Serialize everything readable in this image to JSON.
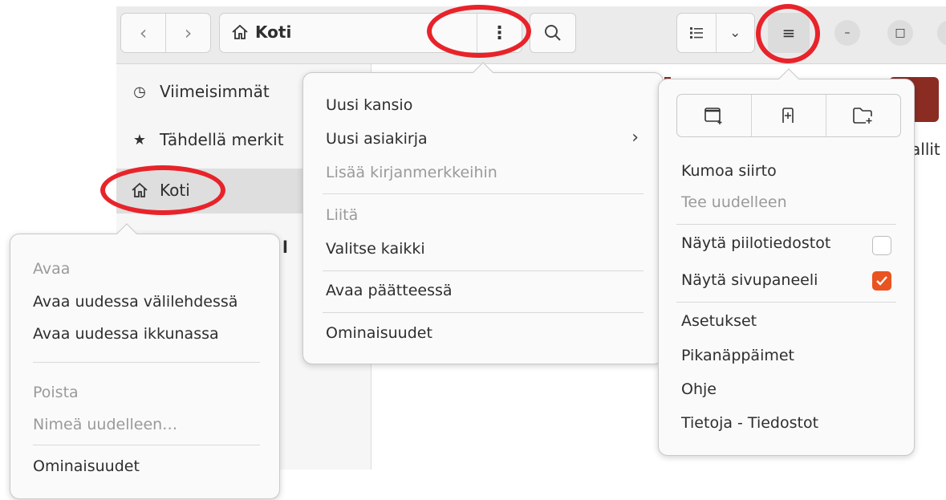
{
  "header": {
    "back_icon": "chevron-left-icon",
    "forward_icon": "chevron-right-icon",
    "path_label": "Koti",
    "path_icon": "home-icon",
    "path_menu_icon": "vertical-dots-icon",
    "search_icon": "search-icon",
    "view_icon": "list-view-icon",
    "view_dropdown_icon": "chevron-down-icon",
    "main_menu_icon": "hamburger-menu-icon",
    "minimize_icon": "minimize-icon",
    "maximize_icon": "maximize-icon"
  },
  "sidebar": {
    "items": [
      {
        "label": "Viimeisimmät",
        "icon": "clock-icon"
      },
      {
        "label": "Tähdellä merkit",
        "icon": "star-icon"
      },
      {
        "label": "Koti",
        "icon": "home-icon"
      }
    ]
  },
  "content": {
    "partial_label_1": "allit",
    "partial_label_2": "l"
  },
  "path_menu": {
    "items": [
      {
        "label": "Uusi kansio",
        "disabled": false
      },
      {
        "label": "Uusi asiakirja",
        "disabled": false,
        "submenu": true
      },
      {
        "label": "Lisää kirjanmerkkeihin",
        "disabled": true
      },
      {
        "label": "Liitä",
        "disabled": true
      },
      {
        "label": "Valitse kaikki",
        "disabled": false
      },
      {
        "label": "Avaa päätteessä",
        "disabled": false
      },
      {
        "label": "Ominaisuudet",
        "disabled": false
      }
    ]
  },
  "sidebar_menu": {
    "items": [
      {
        "label": "Avaa",
        "disabled": true
      },
      {
        "label": "Avaa uudessa välilehdessä",
        "disabled": false
      },
      {
        "label": "Avaa uudessa ikkunassa",
        "disabled": false
      },
      {
        "label": "Poista",
        "disabled": true
      },
      {
        "label": "Nimeä uudelleen…",
        "disabled": true
      },
      {
        "label": "Ominaisuudet",
        "disabled": false
      }
    ]
  },
  "main_menu": {
    "icon_buttons": [
      "new-window-icon",
      "new-tab-icon",
      "new-folder-icon"
    ],
    "items": [
      {
        "label": "Kumoa siirto",
        "disabled": false
      },
      {
        "label": "Tee uudelleen",
        "disabled": true
      },
      {
        "label": "Näytä piilotiedostot",
        "checked": false
      },
      {
        "label": "Näytä sivupaneeli",
        "checked": true
      },
      {
        "label": "Asetukset"
      },
      {
        "label": "Pikanäppäimet"
      },
      {
        "label": "Ohje"
      },
      {
        "label": "Tietoja - Tiedostot"
      }
    ]
  },
  "colors": {
    "annotation": "#e8232a",
    "accent": "#e95420"
  }
}
